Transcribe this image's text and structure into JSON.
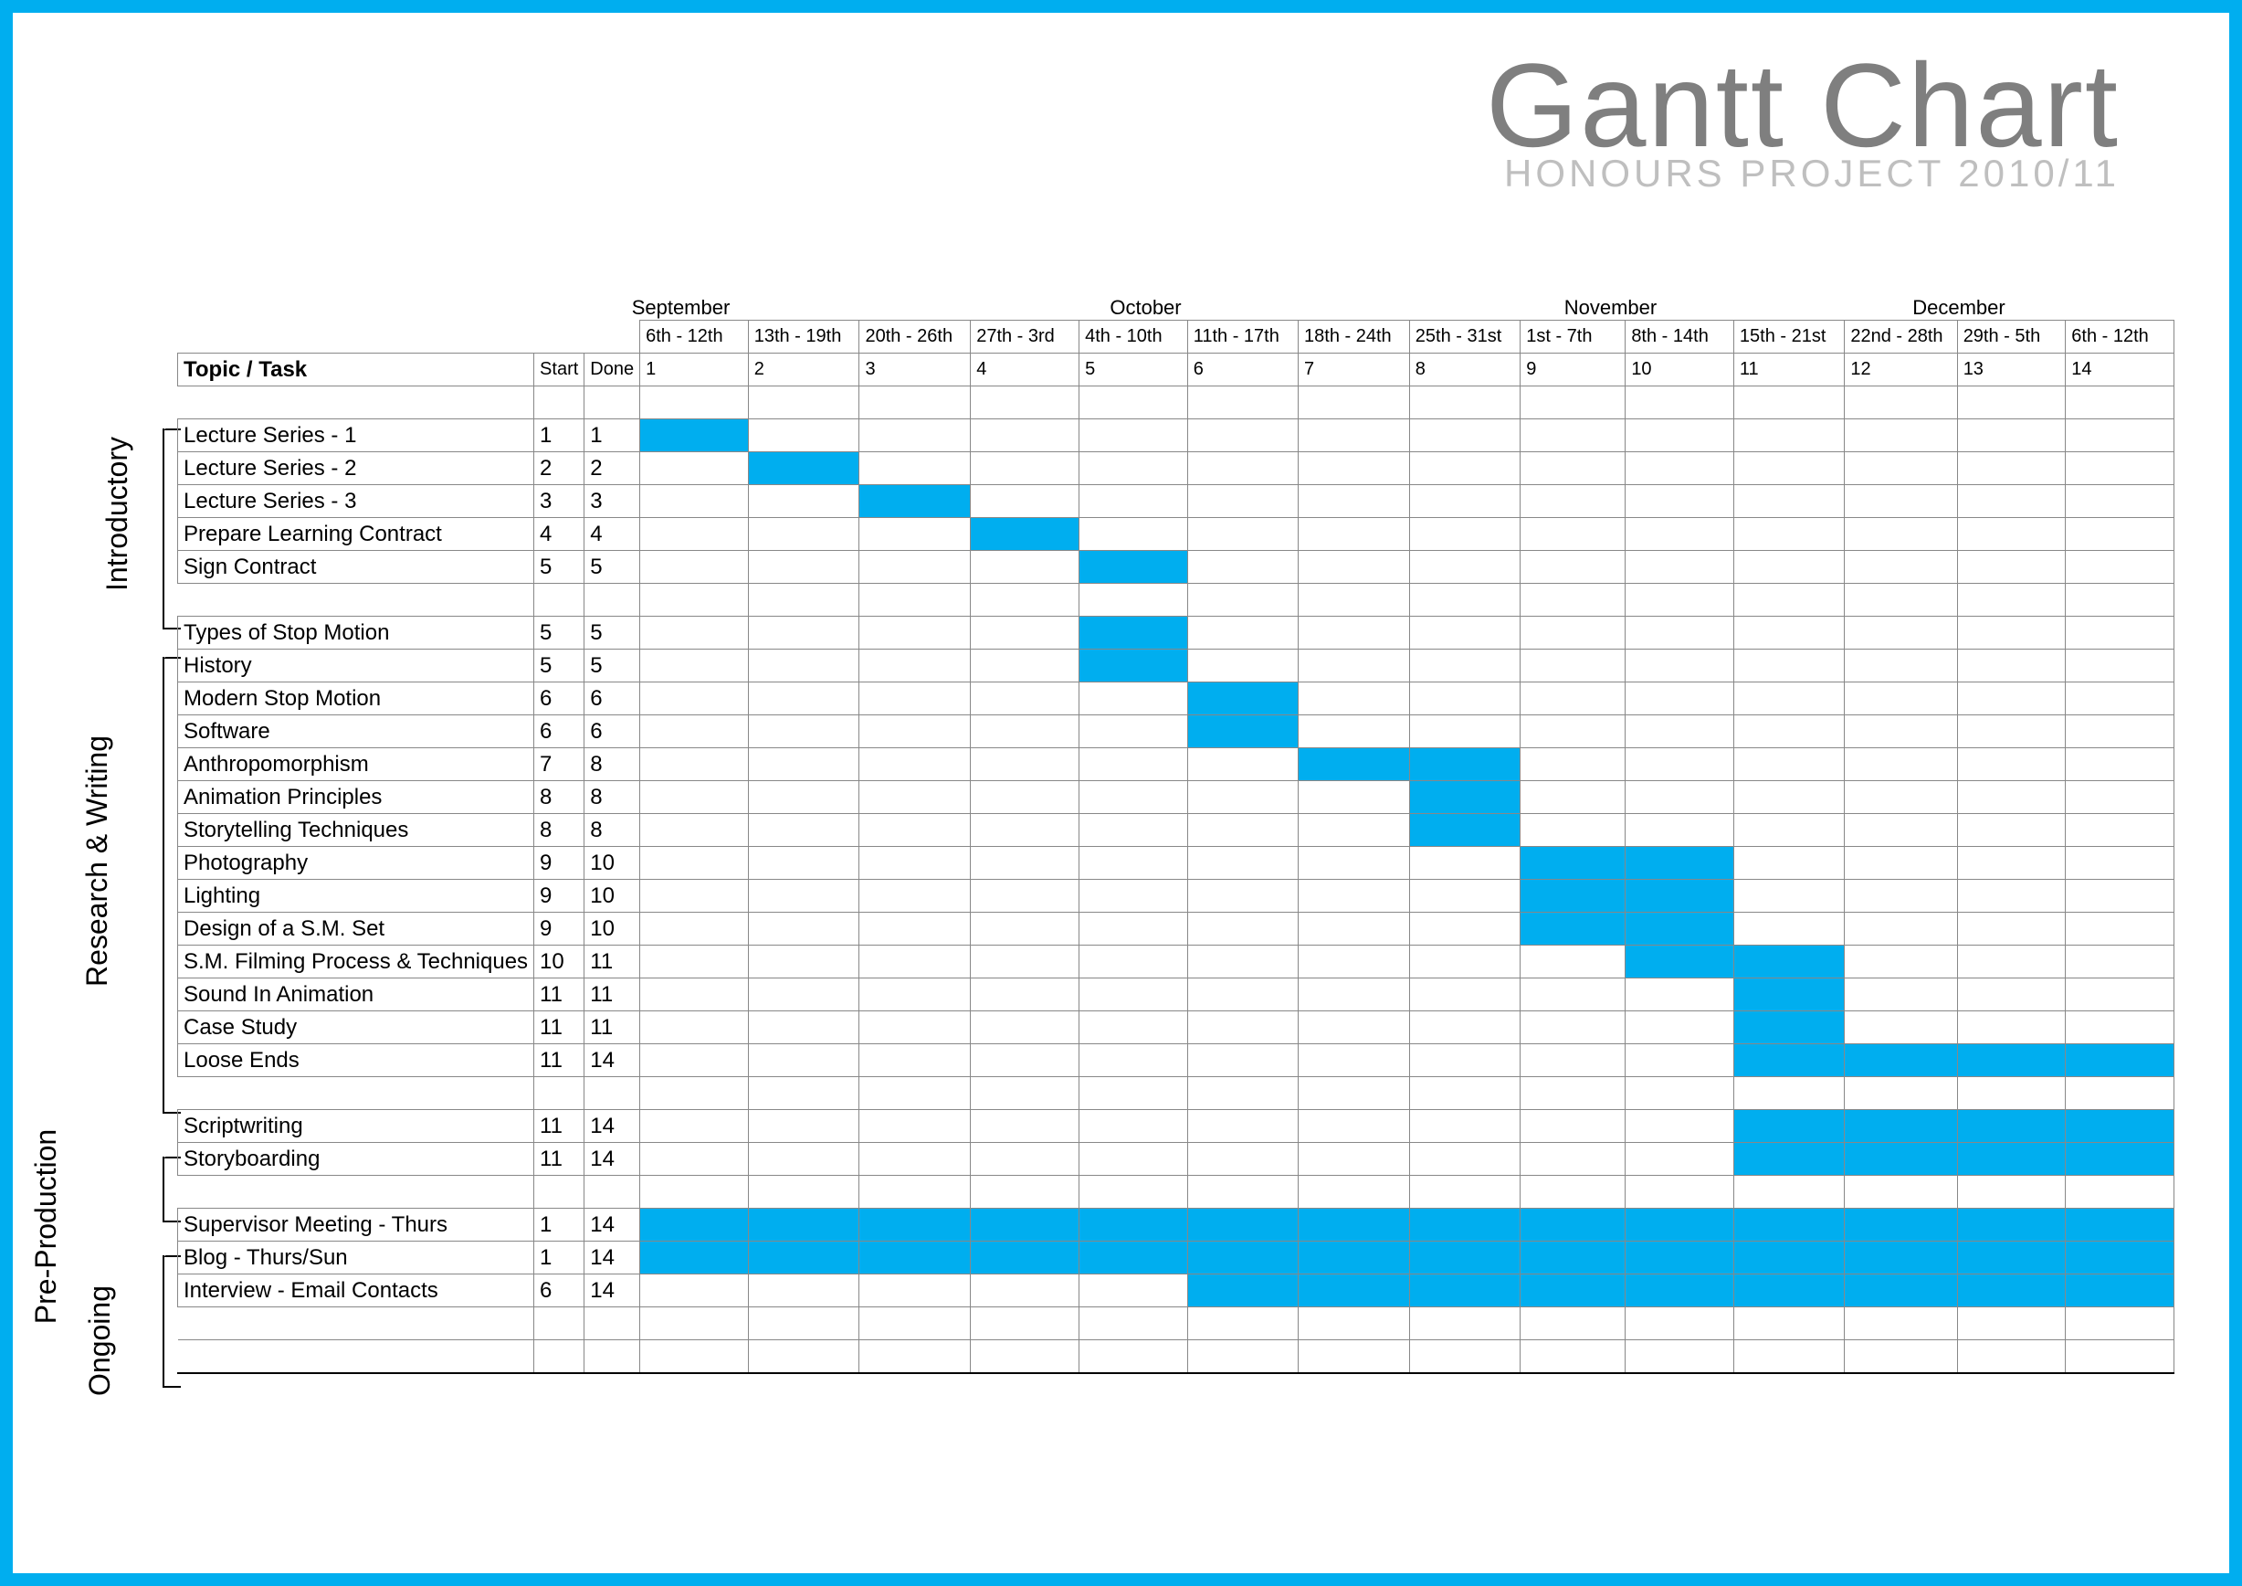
{
  "title": "Gantt Chart",
  "subtitle": "HONOURS PROJECT 2010/11",
  "header": {
    "topic_task": "Topic / Task",
    "start": "Start",
    "done": "Done"
  },
  "months": [
    {
      "name": "September",
      "weeks": [
        "6th - 12th",
        "13th - 19th",
        "20th - 26th",
        "27th - 3rd"
      ]
    },
    {
      "name": "October",
      "weeks": [
        "4th - 10th",
        "11th - 17th",
        "18th - 24th",
        "25th - 31st"
      ]
    },
    {
      "name": "November",
      "weeks": [
        "1st - 7th",
        "8th - 14th",
        "15th - 21st",
        "22nd - 28th"
      ]
    },
    {
      "name": "December",
      "weeks": [
        "29th - 5th",
        "6th - 12th"
      ]
    }
  ],
  "week_numbers": [
    1,
    2,
    3,
    4,
    5,
    6,
    7,
    8,
    9,
    10,
    11,
    12,
    13,
    14
  ],
  "sections": [
    {
      "label": "Introductory",
      "rows": [
        {
          "spacer": true
        },
        {
          "task": "Lecture Series - 1",
          "start": 1,
          "done": 1,
          "bar": [
            1,
            1
          ]
        },
        {
          "task": "Lecture Series - 2",
          "start": 2,
          "done": 2,
          "bar": [
            2,
            2
          ]
        },
        {
          "task": "Lecture Series - 3",
          "start": 3,
          "done": 3,
          "bar": [
            3,
            3
          ]
        },
        {
          "task": "Prepare Learning Contract",
          "start": 4,
          "done": 4,
          "bar": [
            4,
            4
          ]
        },
        {
          "task": "Sign Contract",
          "start": 5,
          "done": 5,
          "bar": [
            5,
            5
          ]
        },
        {
          "spacer": true
        }
      ]
    },
    {
      "label": "Research & Writing",
      "rows": [
        {
          "task": "Types of Stop Motion",
          "start": 5,
          "done": 5,
          "bar": [
            5,
            5
          ]
        },
        {
          "task": "History",
          "start": 5,
          "done": 5,
          "bar": [
            5,
            5
          ]
        },
        {
          "task": "Modern Stop Motion",
          "start": 6,
          "done": 6,
          "bar": [
            6,
            6
          ]
        },
        {
          "task": "Software",
          "start": 6,
          "done": 6,
          "bar": [
            6,
            6
          ]
        },
        {
          "task": "Anthropomorphism",
          "start": 7,
          "done": 8,
          "bar": [
            7,
            8
          ]
        },
        {
          "task": "Animation Principles",
          "start": 8,
          "done": 8,
          "bar": [
            8,
            8
          ]
        },
        {
          "task": "Storytelling Techniques",
          "start": 8,
          "done": 8,
          "bar": [
            8,
            8
          ]
        },
        {
          "task": "Photography",
          "start": 9,
          "done": 10,
          "bar": [
            9,
            10
          ]
        },
        {
          "task": "Lighting",
          "start": 9,
          "done": 10,
          "bar": [
            9,
            10
          ]
        },
        {
          "task": "Design of a S.M. Set",
          "start": 9,
          "done": 10,
          "bar": [
            9,
            10
          ]
        },
        {
          "task": "S.M. Filming Process & Techniques",
          "start": 10,
          "done": 11,
          "bar": [
            10,
            11
          ]
        },
        {
          "task": "Sound In Animation",
          "start": 11,
          "done": 11,
          "bar": [
            11,
            11
          ]
        },
        {
          "task": "Case Study",
          "start": 11,
          "done": 11,
          "bar": [
            11,
            11
          ]
        },
        {
          "task": "Loose Ends",
          "start": 11,
          "done": 14,
          "bar": [
            11,
            14
          ]
        },
        {
          "spacer": true
        }
      ]
    },
    {
      "label": "Pre-Production",
      "rows": [
        {
          "task": "Scriptwriting",
          "start": 11,
          "done": 14,
          "bar": [
            11,
            14
          ]
        },
        {
          "task": "Storyboarding",
          "start": 11,
          "done": 14,
          "bar": [
            11,
            14
          ]
        },
        {
          "spacer": true
        }
      ]
    },
    {
      "label": "Ongoing",
      "rows": [
        {
          "task": "Supervisor Meeting - Thurs",
          "start": 1,
          "done": 14,
          "bar": [
            1,
            14
          ]
        },
        {
          "task": "Blog - Thurs/Sun",
          "start": 1,
          "done": 14,
          "bar": [
            1,
            14
          ]
        },
        {
          "task": "Interview - Email Contacts",
          "start": 6,
          "done": 14,
          "bar": [
            6,
            14
          ]
        },
        {
          "spacer": true
        },
        {
          "spacer": true
        }
      ]
    }
  ],
  "chart_data": {
    "type": "gantt",
    "title": "Gantt Chart – Honours Project 2010/11",
    "x_axis": "Week number (1–14, 6 Sep 2010 – 12 Dec 2010)",
    "categories": [
      "Lecture Series - 1",
      "Lecture Series - 2",
      "Lecture Series - 3",
      "Prepare Learning Contract",
      "Sign Contract",
      "Types of Stop Motion",
      "History",
      "Modern Stop Motion",
      "Software",
      "Anthropomorphism",
      "Animation Principles",
      "Storytelling Techniques",
      "Photography",
      "Lighting",
      "Design of a S.M. Set",
      "S.M. Filming Process & Techniques",
      "Sound In Animation",
      "Case Study",
      "Loose Ends",
      "Scriptwriting",
      "Storyboarding",
      "Supervisor Meeting - Thurs",
      "Blog - Thurs/Sun",
      "Interview - Email Contacts"
    ],
    "series": [
      {
        "name": "Start week",
        "values": [
          1,
          2,
          3,
          4,
          5,
          5,
          5,
          6,
          6,
          7,
          8,
          8,
          9,
          9,
          9,
          10,
          11,
          11,
          11,
          11,
          11,
          1,
          1,
          6
        ]
      },
      {
        "name": "End week",
        "values": [
          1,
          2,
          3,
          4,
          5,
          5,
          5,
          6,
          6,
          8,
          8,
          8,
          10,
          10,
          10,
          11,
          11,
          11,
          14,
          14,
          14,
          14,
          14,
          14
        ]
      }
    ],
    "groups": {
      "Introductory": [
        0,
        4
      ],
      "Research & Writing": [
        5,
        18
      ],
      "Pre-Production": [
        19,
        20
      ],
      "Ongoing": [
        21,
        23
      ]
    },
    "xlim": [
      1,
      14
    ],
    "week_dates": [
      "6th - 12th Sep",
      "13th - 19th Sep",
      "20th - 26th Sep",
      "27th Sep - 3rd Oct",
      "4th - 10th Oct",
      "11th - 17th Oct",
      "18th - 24th Oct",
      "25th - 31st Oct",
      "1st - 7th Nov",
      "8th - 14th Nov",
      "15th - 21st Nov",
      "22nd - 28th Nov",
      "29th Nov - 5th Dec",
      "6th - 12th Dec"
    ],
    "bar_color": "#00aeef"
  }
}
